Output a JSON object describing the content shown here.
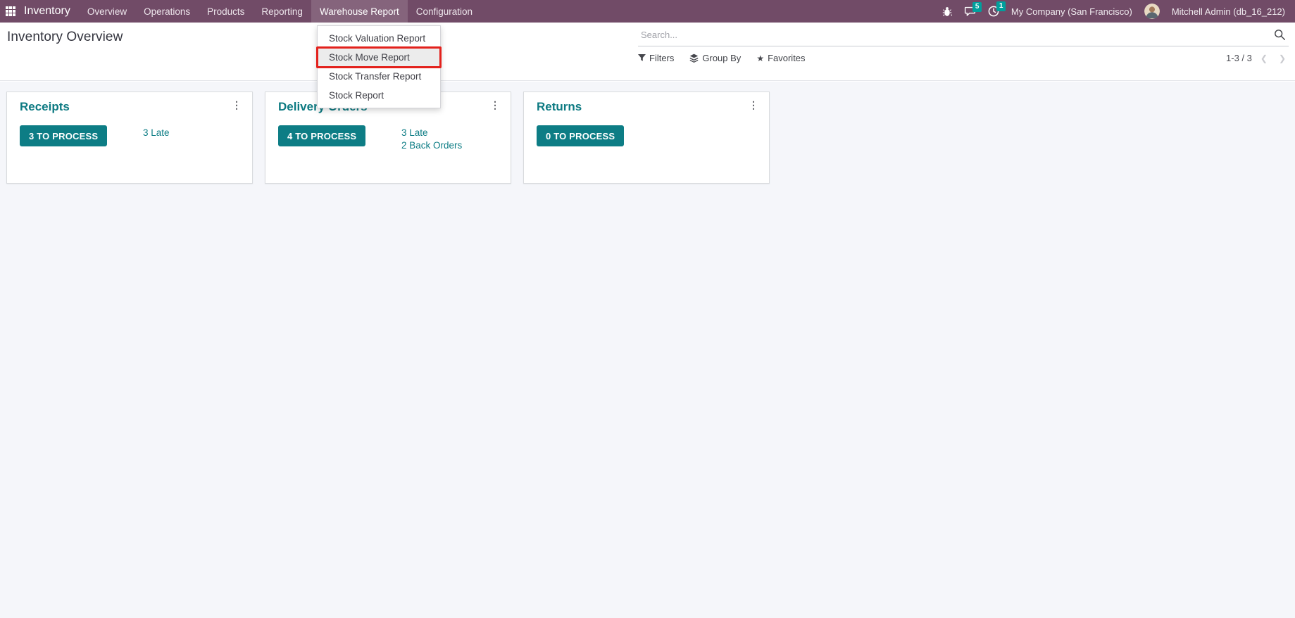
{
  "topbar": {
    "brand": "Inventory",
    "menus": [
      "Overview",
      "Operations",
      "Products",
      "Reporting",
      "Warehouse Report",
      "Configuration"
    ],
    "active_menu": "Warehouse Report",
    "systray": {
      "chat_badge": "5",
      "activity_badge": "1",
      "company": "My Company (San Francisco)",
      "user": "Mitchell Admin (db_16_212)"
    }
  },
  "dropdown": {
    "items": [
      "Stock Valuation Report",
      "Stock Move Report",
      "Stock Transfer Report",
      "Stock Report"
    ],
    "highlighted_item": "Stock Move Report"
  },
  "control_panel": {
    "title": "Inventory Overview",
    "search_placeholder": "Search...",
    "filters_label": "Filters",
    "group_by_label": "Group By",
    "favorites_label": "Favorites",
    "pager": "1-3 / 3"
  },
  "cards": [
    {
      "title": "Receipts",
      "button": "3 TO PROCESS",
      "links": [
        "3 Late"
      ]
    },
    {
      "title": "Delivery Orders",
      "button": "4 TO PROCESS",
      "links": [
        "3 Late",
        "2 Back Orders"
      ]
    },
    {
      "title": "Returns",
      "button": "0 TO PROCESS",
      "links": []
    }
  ],
  "icons": {
    "star_glyph": "★",
    "kebab_glyph": "⋮",
    "chevron_left_glyph": "❮",
    "chevron_right_glyph": "❯"
  },
  "colors": {
    "navbar": "#714B67",
    "accent_teal": "#0d7d85",
    "badge_teal": "#00A09D",
    "annotation_red": "#e3211c",
    "content_bg": "#f5f6fa"
  }
}
